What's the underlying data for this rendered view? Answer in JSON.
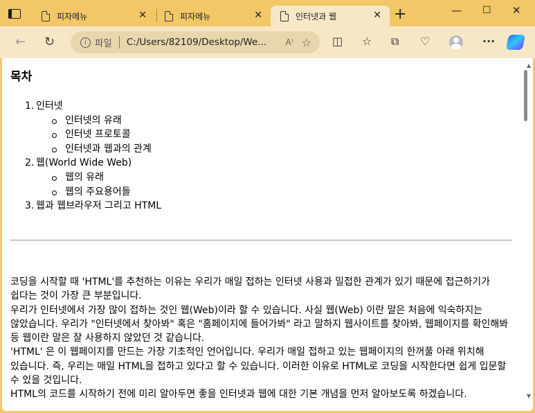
{
  "tabs": [
    {
      "label": "피자메뉴",
      "active": false
    },
    {
      "label": "피자메뉴",
      "active": false
    },
    {
      "label": "인터넷과 웹",
      "active": true
    }
  ],
  "window": {
    "minimize": "—",
    "maximize": "☐",
    "close": "✕"
  },
  "address": {
    "info_icon": "i",
    "file_label": "파일",
    "url": "C:/Users/82109/Desktop/We...",
    "read_icon": "A⁾"
  },
  "page": {
    "toc_title": "목차",
    "toc": [
      {
        "num": "1.",
        "label": "인터넷",
        "sub": [
          "인터넷의 유래",
          "인터넷 프로토콜",
          "인터넷과 웹과의 관계"
        ]
      },
      {
        "num": "2.",
        "label": "웹(World Wide Web)",
        "sub": [
          "웹의 유래",
          "웹의 주요용어들"
        ]
      },
      {
        "num": "3.",
        "label": "웹과 웹브라우저 그리고 HTML",
        "sub": []
      }
    ],
    "paragraphs": [
      "코딩을 시작할 때 'HTML'를 추천하는 이유는 우리가 매일 접하는 인터넷 사용과 밀접한 관계가 있기 때문에 접근하기가 쉽다는 것이 가장 큰 부분입니다.",
      "우리가 인터넷에서 가장 많이 접하는 것인 웹(Web)이라 할 수 있습니다. 사실 웹(Web) 이란 말은 처음에 익숙하지는 않았습니다. 우리가 \"인터넷에서 찾아봐\" 혹은 \"홈페이지에 들어가봐\" 라고 말하지 웹사이트를 찾아봐, 웹페이지를 확인해봐 등 웹이란 말은 잘 사용하지 않았던 것 같습니다.",
      "'HTML' 은 이 웹페이지를 만드는 가장 기초적인 언어입니다. 우리가 매일 접하고 있는 웹페이지의 한꺼풀 아래 위치해 있습니다. 즉, 우리는 매일 HTML을 접하고 있다고 할 수 있습니다. 이러한 이유로 HTML로 코딩을 시작한다면 쉽게 입문할 수 있을 것입니다.",
      "HTML의 코드를 시작하기 전에 미리 알아두면 좋을 인터넷과 웹에 대한 기본 개념을 먼저 알아보도록 하겠습니다."
    ]
  },
  "colors": {
    "titlebar": "#f1c767",
    "toolbar": "#f6e8c6",
    "active_tab": "#f6e8c6",
    "address_bg": "#e8d6ad"
  }
}
